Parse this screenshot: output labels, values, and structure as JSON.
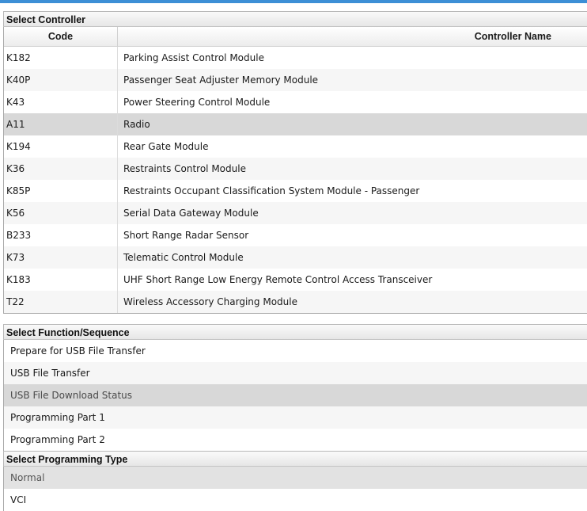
{
  "controller_section": {
    "title": "Select Controller",
    "headers": {
      "code": "Code",
      "name": "Controller Name"
    },
    "rows": [
      {
        "code": "K182",
        "name": "Parking Assist Control Module"
      },
      {
        "code": "K40P",
        "name": "Passenger Seat Adjuster Memory Module"
      },
      {
        "code": "K43",
        "name": "Power Steering Control Module"
      },
      {
        "code": "A11",
        "name": "Radio",
        "selected": true
      },
      {
        "code": "K194",
        "name": "Rear Gate Module"
      },
      {
        "code": "K36",
        "name": "Restraints Control Module"
      },
      {
        "code": "K85P",
        "name": "Restraints Occupant Classification System Module - Passenger"
      },
      {
        "code": "K56",
        "name": "Serial Data Gateway Module"
      },
      {
        "code": "B233",
        "name": "Short Range Radar Sensor"
      },
      {
        "code": "K73",
        "name": "Telematic Control Module"
      },
      {
        "code": "K183",
        "name": "UHF Short Range Low Energy Remote Control Access Transceiver"
      },
      {
        "code": "T22",
        "name": "Wireless Accessory Charging Module"
      }
    ]
  },
  "function_section": {
    "title": "Select Function/Sequence",
    "items": [
      {
        "label": "Prepare for USB File Transfer"
      },
      {
        "label": "USB File Transfer"
      },
      {
        "label": "USB File Download Status",
        "selected": true
      },
      {
        "label": "Programming Part 1"
      },
      {
        "label": "Programming Part 2"
      }
    ]
  },
  "programming_type_section": {
    "title": "Select Programming Type",
    "items": [
      {
        "label": "Normal",
        "selected": true
      },
      {
        "label": "VCI"
      }
    ]
  },
  "colors": {
    "accent": "#3d8fd6",
    "selected_row": "#d8d8d8",
    "alt_row": "#f6f6f6"
  }
}
